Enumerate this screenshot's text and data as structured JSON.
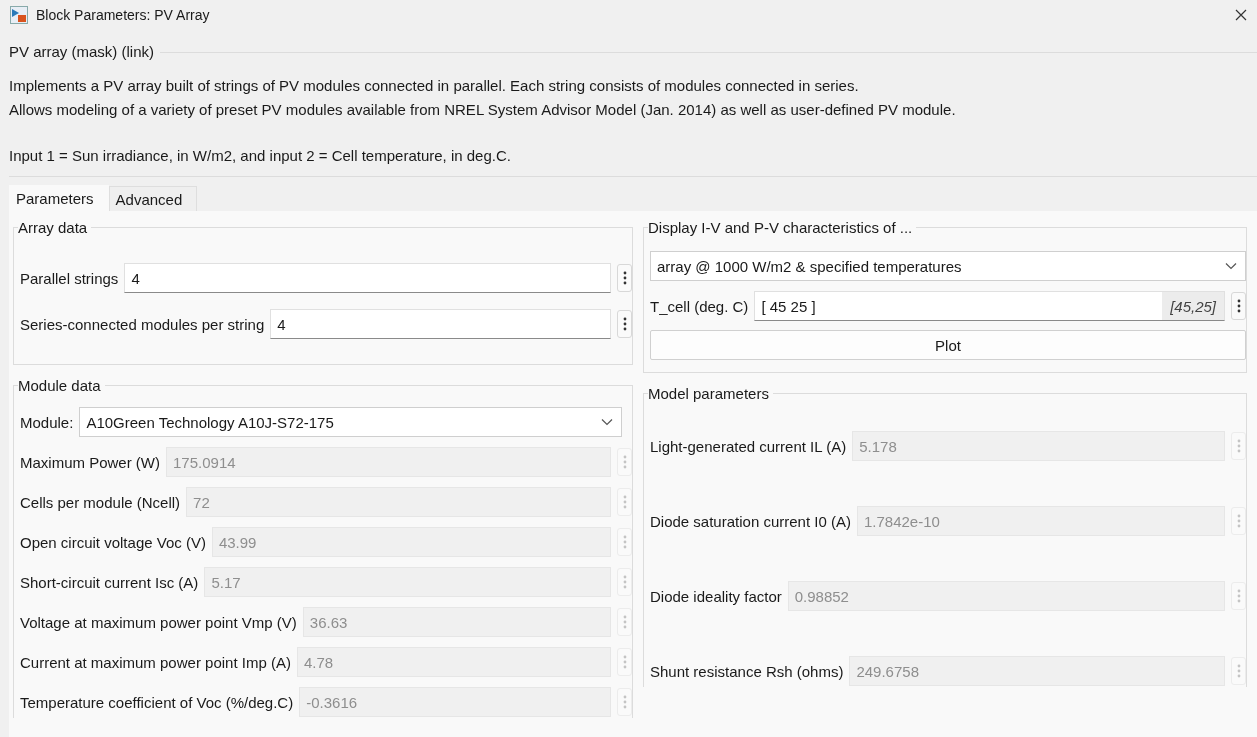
{
  "window": {
    "title": "Block Parameters: PV Array"
  },
  "header": {
    "title": "PV array (mask) (link)",
    "description": [
      "Implements a PV array built of strings of PV modules connected in parallel. Each string consists of modules connected in series.",
      "Allows modeling of a variety of preset PV modules available from NREL System Advisor Model (Jan. 2014) as well as user-defined PV module."
    ],
    "note": "Input 1 = Sun irradiance, in W/m2, and input 2 = Cell temperature, in deg.C."
  },
  "tabs": [
    {
      "label": "Parameters",
      "selected": true
    },
    {
      "label": "Advanced",
      "selected": false
    }
  ],
  "array_data": {
    "title": "Array data",
    "fields": [
      {
        "label": "Parallel strings",
        "value": "4",
        "disabled": false
      },
      {
        "label": "Series-connected modules per string",
        "value": "4",
        "disabled": false
      }
    ]
  },
  "display": {
    "title": "Display  I-V and P-V characteristics of ...",
    "dropdown": {
      "value": "array @ 1000 W/m2 & specified temperatures"
    },
    "t_cell": {
      "label": "T_cell (deg. C)",
      "value": "[ 45 25  ]",
      "evaluated": "[45,25]",
      "disabled": false
    },
    "plot_button": "Plot"
  },
  "module_data": {
    "title": "Module data",
    "module": {
      "label": "Module:",
      "value": "A10Green Technology A10J-S72-175"
    },
    "fields": [
      {
        "label": "Maximum Power (W)",
        "value": "175.0914",
        "disabled": true
      },
      {
        "label": "Cells per module (Ncell)",
        "value": "72",
        "disabled": true
      },
      {
        "label": "Open circuit voltage  Voc (V)",
        "value": "43.99",
        "disabled": true
      },
      {
        "label": "Short-circuit current Isc (A)",
        "value": "5.17",
        "disabled": true
      },
      {
        "label": "Voltage at maximum power point Vmp (V)",
        "value": "36.63",
        "disabled": true
      },
      {
        "label": "Current at maximum power point Imp (A)",
        "value": "4.78",
        "disabled": true
      },
      {
        "label": "Temperature coefficient of Voc (%/deg.C)",
        "value": "-0.3616",
        "disabled": true
      }
    ]
  },
  "model_parameters": {
    "title": "Model parameters",
    "fields": [
      {
        "label": "Light-generated current IL (A)",
        "value": "5.178",
        "disabled": true
      },
      {
        "label": "Diode saturation current I0 (A)",
        "value": "1.7842e-10",
        "disabled": true
      },
      {
        "label": "Diode ideality factor",
        "value": "0.98852",
        "disabled": true
      },
      {
        "label": "Shunt resistance Rsh (ohms)",
        "value": "249.6758",
        "disabled": true
      }
    ]
  }
}
